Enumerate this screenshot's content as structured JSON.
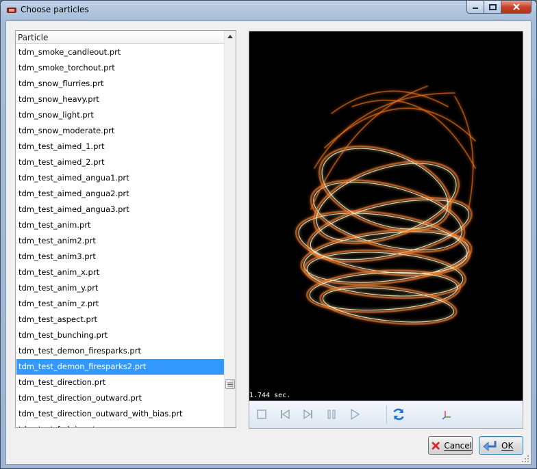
{
  "window": {
    "title": "Choose particles"
  },
  "list": {
    "header": "Particle",
    "items": [
      "tdm_smoke_candleout.prt",
      "tdm_smoke_torchout.prt",
      "tdm_snow_flurries.prt",
      "tdm_snow_heavy.prt",
      "tdm_snow_light.prt",
      "tdm_snow_moderate.prt",
      "tdm_test_aimed_1.prt",
      "tdm_test_aimed_2.prt",
      "tdm_test_aimed_angua1.prt",
      "tdm_test_aimed_angua2.prt",
      "tdm_test_aimed_angua3.prt",
      "tdm_test_anim.prt",
      "tdm_test_anim2.prt",
      "tdm_test_anim3.prt",
      "tdm_test_anim_x.prt",
      "tdm_test_anim_y.prt",
      "tdm_test_anim_z.prt",
      "tdm_test_aspect.prt",
      "tdm_test_bunching.prt",
      "tdm_test_demon_firesparks.prt",
      "tdm_test_demon_firesparks2.prt",
      "tdm_test_direction.prt",
      "tdm_test_direction_outward.prt",
      "tdm_test_direction_outward_with_bias.prt",
      "tdm_test_fadein.prt"
    ],
    "selected_index": 20
  },
  "preview": {
    "time_label": "1.744 sec.",
    "controls": [
      "stop-icon",
      "skip-back-icon",
      "step-forward-icon",
      "pause-icon",
      "play-icon",
      "refresh-icon",
      "axes-icon"
    ]
  },
  "buttons": {
    "cancel": "Cancel",
    "ok": "OK"
  },
  "colors": {
    "selection": "#3399ff",
    "spark_core": "#fff3c0",
    "spark_glow": "#ff7a1a"
  }
}
